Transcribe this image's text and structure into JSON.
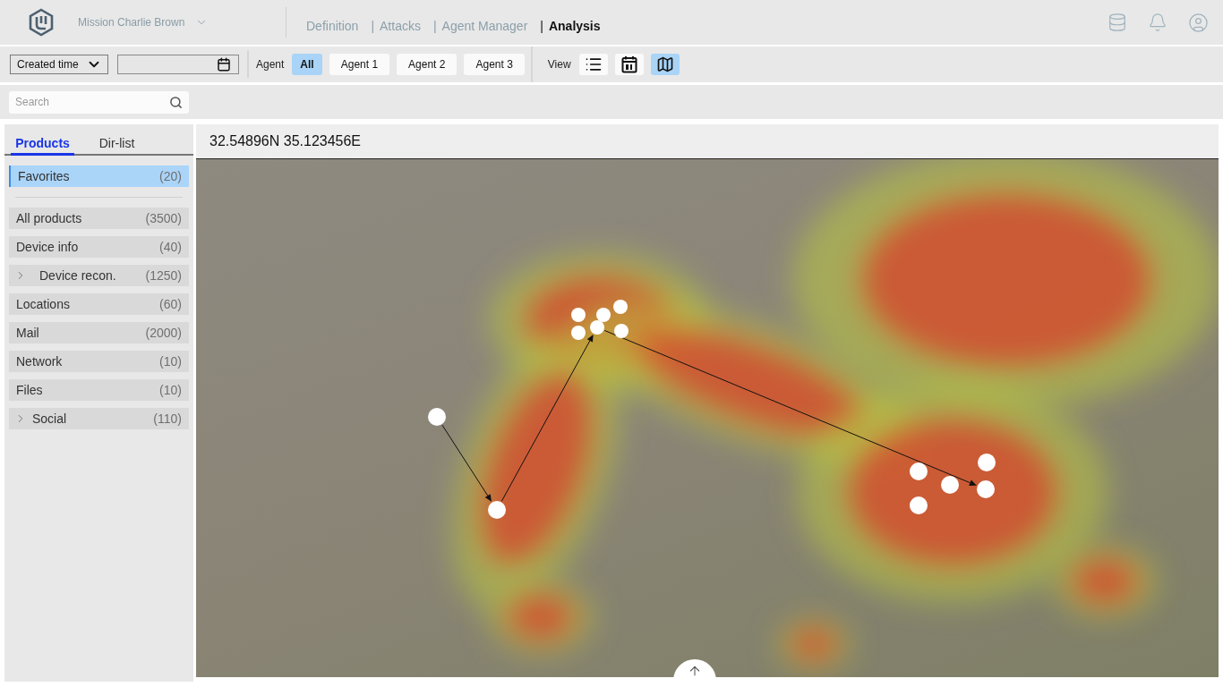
{
  "header": {
    "mission": "Mission Charlie Brown",
    "nav": [
      {
        "label": "Definition",
        "separator": false,
        "selected": false
      },
      {
        "label": "Attacks",
        "separator": true,
        "selected": false
      },
      {
        "label": "Agent Manager",
        "separator": true,
        "selected": false
      },
      {
        "label": "Analysis",
        "separator": true,
        "selected": true
      }
    ],
    "separator_char": "|"
  },
  "toolbar": {
    "time_filter": "Created time",
    "agent": {
      "label": "Agent",
      "options": [
        {
          "label": "All",
          "selected": true
        },
        {
          "label": "Agent 1",
          "selected": false
        },
        {
          "label": "Agent 2",
          "selected": false
        },
        {
          "label": "Agent 3",
          "selected": false
        }
      ]
    },
    "view": {
      "label": "View",
      "modes": [
        {
          "kind": "list",
          "selected": false
        },
        {
          "kind": "calendar",
          "selected": false
        },
        {
          "kind": "map",
          "selected": true
        }
      ]
    }
  },
  "search": {
    "placeholder": "Search"
  },
  "sidebar": {
    "tabs": [
      {
        "label": "Products",
        "selected": true
      },
      {
        "label": "Dir-list",
        "selected": false
      }
    ],
    "favorites": {
      "label": "Favorites",
      "count": "(20)",
      "selected": true
    },
    "items": [
      {
        "kind": "item",
        "label": "All products",
        "count": "(3500)",
        "selected": false
      },
      {
        "kind": "item",
        "label": "Device info",
        "count": "(40)",
        "selected": false
      },
      {
        "kind": "group",
        "label": "Device recon.",
        "count": "(1250)",
        "selected": false,
        "expanded": false
      },
      {
        "kind": "item",
        "label": "Locations",
        "count": "(60)",
        "selected": false
      },
      {
        "kind": "item",
        "label": "Mail",
        "count": "(2000)",
        "selected": false
      },
      {
        "kind": "item",
        "label": "Network",
        "count": "(10)",
        "selected": false
      },
      {
        "kind": "item",
        "label": "Files",
        "count": "(10)",
        "selected": false
      },
      {
        "kind": "group",
        "label": "Social",
        "count": "(110)",
        "selected": false,
        "expanded": false
      }
    ]
  },
  "map": {
    "coordinates": "32.54896N 35.123456E"
  }
}
